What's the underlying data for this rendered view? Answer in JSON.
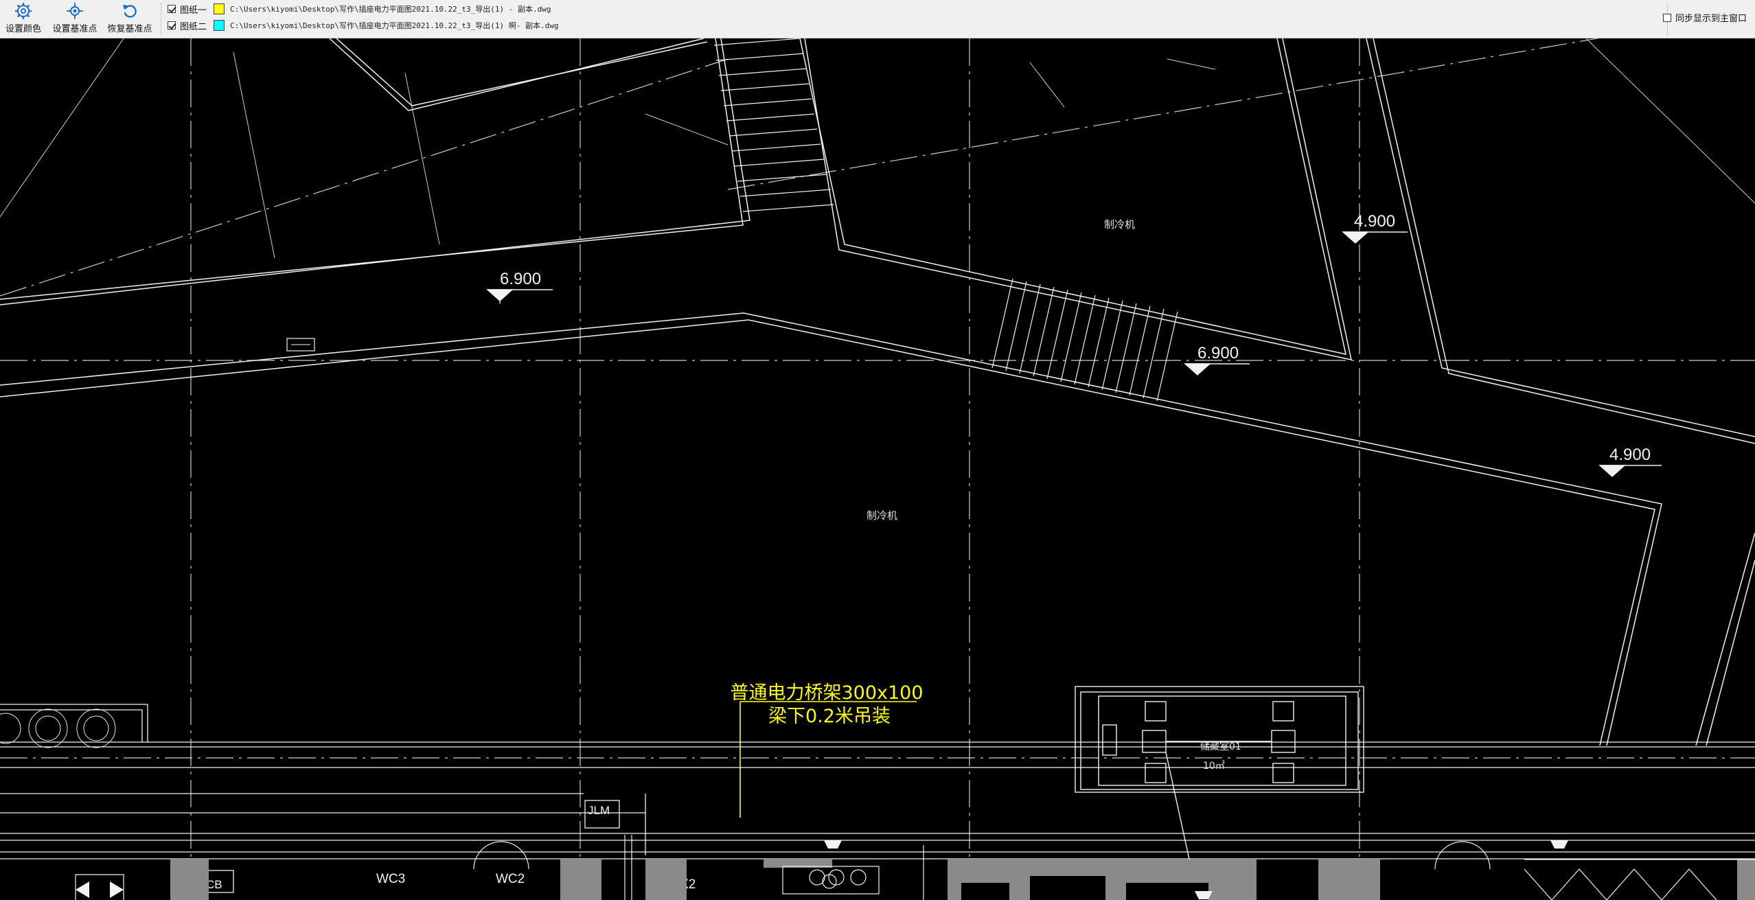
{
  "toolbar": {
    "set_color_label": "设置颜色",
    "set_base_label": "设置基准点",
    "restore_base_label": "恢复基准点",
    "drawings": [
      {
        "checked": true,
        "name": "图纸一",
        "color": "#ffff00",
        "path": "C:\\Users\\kiyomi\\Desktop\\写作\\插座电力平面图2021.10.22_t3_导出(1) - 副本.dwg"
      },
      {
        "checked": true,
        "name": "图纸二",
        "color": "#00ffff",
        "path": "C:\\Users\\kiyomi\\Desktop\\写作\\插座电力平面图2021.10.22_t3_导出(1) 啊- 副本.dwg"
      }
    ],
    "sync_label": "同步显示到主窗口",
    "sync_checked": false
  },
  "drawing": {
    "elevations": [
      "6.900",
      "4.900",
      "6.900",
      "4.900"
    ],
    "annotation_line1": "普通电力桥架300x100",
    "annotation_line2": "梁下0.2米吊装",
    "labels": {
      "room_small_1": "制冷机",
      "room_small_2": "制冷机",
      "jlm": "JLM",
      "cb": "CB",
      "wc3": "WC3",
      "wc2": "WC2",
      "jlx2": "JLX2",
      "room_name": "储藏室01",
      "room_area": "10㎡"
    },
    "colors": {
      "background": "#000000",
      "line": "#ffffff",
      "annotation": "#ffff00",
      "grid": "#cfcfcf",
      "fill_gray": "#8a8a8a"
    }
  }
}
